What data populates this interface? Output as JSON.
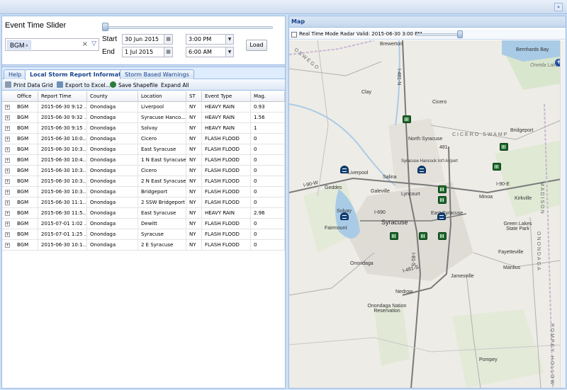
{
  "slider": {
    "title": "Event Time Slider"
  },
  "filters": {
    "office_tag": "BGM",
    "start_label": "Start",
    "end_label": "End",
    "start_date": "30 Jun 2015",
    "start_time": "3:00 PM",
    "end_date": "1 Jul 2015",
    "end_time": "6:00 AM",
    "load_label": "Load"
  },
  "tabs": [
    "Help",
    "Local Storm Report Information",
    "Storm Based Warnings"
  ],
  "toolbar": {
    "print": "Print Data Grid",
    "export": "Export to Excel...",
    "shapefile": "Save Shapefile",
    "expand": "Expand All"
  },
  "grid": {
    "columns": [
      "Office",
      "Report Time",
      "County",
      "Location",
      "ST",
      "Event Type",
      "Mag."
    ],
    "rows": [
      [
        "BGM",
        "2015-06-30 9:12 ...",
        "Onondaga",
        "Liverpool",
        "NY",
        "HEAVY RAIN",
        "0.93"
      ],
      [
        "BGM",
        "2015-06-30 9:32 ...",
        "Onondaga",
        "Syracuse Hanco...",
        "NY",
        "HEAVY RAIN",
        "1.56"
      ],
      [
        "BGM",
        "2015-06-30 9:15 ...",
        "Onondaga",
        "Solvay",
        "NY",
        "HEAVY RAIN",
        "1"
      ],
      [
        "BGM",
        "2015-06-30 10:0...",
        "Onondaga",
        "Cicero",
        "NY",
        "FLASH FLOOD",
        "0"
      ],
      [
        "BGM",
        "2015-06-30 10:3...",
        "Onondaga",
        "East Syracuse",
        "NY",
        "FLASH FLOOD",
        "0"
      ],
      [
        "BGM",
        "2015-06-30 10:4...",
        "Onondaga",
        "1 N East Syracuse",
        "NY",
        "FLASH FLOOD",
        "0"
      ],
      [
        "BGM",
        "2015-06-30 10:3...",
        "Onondaga",
        "Cicero",
        "NY",
        "FLASH FLOOD",
        "0"
      ],
      [
        "BGM",
        "2015-06-30 10:3...",
        "Onondaga",
        "2 N East Syracuse",
        "NY",
        "FLASH FLOOD",
        "0"
      ],
      [
        "BGM",
        "2015-06-30 10:3...",
        "Onondaga",
        "Bridgeport",
        "NY",
        "FLASH FLOOD",
        "0"
      ],
      [
        "BGM",
        "2015-06-30 11:1...",
        "Onondaga",
        "2 SSW Bridgeport",
        "NY",
        "FLASH FLOOD",
        "0"
      ],
      [
        "BGM",
        "2015-06-30 11:5...",
        "Onondaga",
        "East Syracuse",
        "NY",
        "HEAVY RAIN",
        "2.96"
      ],
      [
        "BGM",
        "2015-07-01 1:02 ...",
        "Onondaga",
        "Dewitt",
        "NY",
        "FLASH FLOOD",
        "0"
      ],
      [
        "BGM",
        "2015-07-01 1:25 ...",
        "Onondaga",
        "Syracuse",
        "NY",
        "FLASH FLOOD",
        "0"
      ],
      [
        "BGM",
        "2015-06-30 10:1...",
        "Onondaga",
        "2 E Syracuse",
        "NY",
        "FLASH FLOOD",
        "0"
      ]
    ]
  },
  "map": {
    "title": "Map",
    "realtime_label": "Real Time Mode",
    "radar_label": "Radar Valid: 2015-06-30 3:00 PM",
    "places": [
      "Brewerton",
      "Bernhards Bay",
      "Oneida Lake",
      "Clay",
      "Cicero",
      "Bridgeport",
      "North Syracuse",
      "CICERO SWAMP",
      "Syracuse Hancock Int'l Airport",
      "Liverpool",
      "Salina",
      "Geddes",
      "Galeville",
      "Lyncourt",
      "Minoa",
      "Kirkville",
      "Solvay",
      "East Syracuse",
      "Fairmount",
      "Syracuse",
      "Green Lakes State Park",
      "Fayetteville",
      "Onondaga",
      "Manlius",
      "Jamesville",
      "Nedrow",
      "Onondaga Nation Reservation",
      "Pompey",
      "MADISON",
      "POMPEY HOLLOW",
      "ONONDAGA",
      "OSWEGO"
    ],
    "roads": [
      "I-481-N",
      "I-81-S",
      "I-90-E",
      "I-90-W",
      "I-481-S",
      "I-690",
      "481"
    ],
    "colors": {
      "rain_marker": "#1a6a2a",
      "flood_marker": "#12427a",
      "header_text": "#15428b"
    }
  }
}
